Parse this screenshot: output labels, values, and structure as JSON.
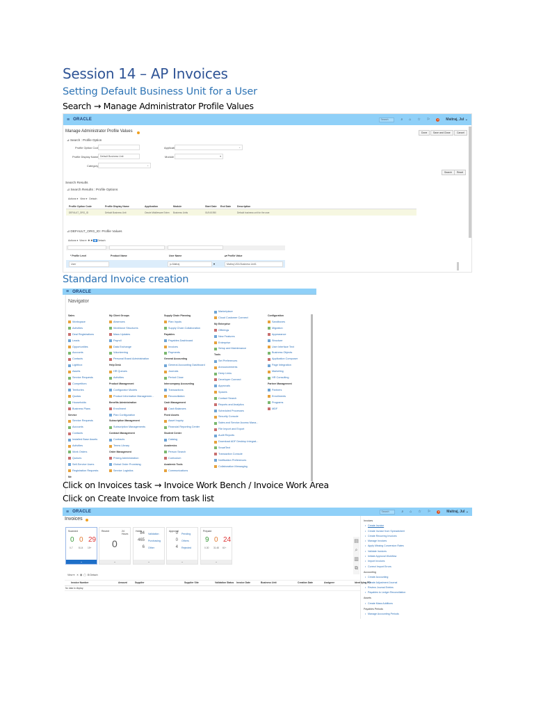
{
  "doc": {
    "title": "Session 14 – AP Invoices",
    "subtitle1": "Setting Default Business Unit for a User",
    "step1": "Search → Manage Administrator Profile Values",
    "subtitle2": "Standard Invoice creation",
    "step2": "Click on Invoices task → Invoice Work Bench / Invoice Work Area",
    "step3": "Click on Create Invoice from task list"
  },
  "topbar": {
    "logo": "ORACLE",
    "search_placeholder": "Search",
    "user": "Maitraj, Jul ⌄",
    "notif_count": "9"
  },
  "profile_screen": {
    "page_title": "Manage Administrator Profile Values",
    "buttons": {
      "done": "Done",
      "save_close": "Save and Close",
      "cancel": "Cancel",
      "search": "Search",
      "reset": "Reset"
    },
    "search_section": "Search : Profile Option",
    "labels": {
      "code": "Profile Option Code",
      "display_name": "Profile Display Name",
      "category": "Category",
      "application": "Application",
      "module": "Module"
    },
    "values": {
      "display_name": "Default Business Unit"
    },
    "results_title": "Search Results",
    "results_section": "Search Results : Profile Options",
    "toolbar": {
      "actions": "Actions ▾",
      "view": "View ▾",
      "detach": "Detach"
    },
    "columns": [
      "Profile Option Code",
      "Profile Display Name",
      "Application",
      "Module",
      "Start Date",
      "End Date",
      "Description"
    ],
    "row": [
      "DEFAULT_ORG_ID",
      "Default Business Unit",
      "Oracle Middleware Exten",
      "Business Units",
      "01/04/1950",
      "",
      "Default business unit for the user."
    ],
    "values_section": "DEFAULT_ORG_ID: Profile Values",
    "values_columns": [
      "* Profile Level",
      "Product Name",
      "User Name",
      "Profile Value"
    ],
    "values_row": {
      "level": "User",
      "product": "",
      "user": "ju.Maitraj",
      "value": "Maitraj USA Business Unit1"
    }
  },
  "navigator": {
    "title": "Navigator",
    "columns": [
      [
        {
          "g": "Sales"
        },
        "Workspace",
        "Activities",
        "Deal Registrations",
        "Leads",
        "Opportunities",
        "Accounts",
        "Contacts",
        "Lightbox",
        "Assets",
        "Service Requests",
        "Competitors",
        "Territories",
        "Quotas",
        "Households",
        "Business Plans",
        {
          "g": "Service"
        },
        "Service Requests",
        "Accounts",
        "Contacts",
        "Installed Base Assets",
        "Activities",
        "Work Orders",
        "Queues",
        "Self-Service Users",
        "Registration Requests",
        {
          "g": "Me"
        }
      ],
      [
        {
          "g": "My Client Groups"
        },
        "Absences",
        "Workforce Structures",
        "Mass Updates",
        "Payroll",
        "Data Exchange",
        "Volunteering",
        "Personal Brand Administration",
        {
          "g": "Help Desk"
        },
        "HR Queues",
        "Activities",
        {
          "g": "Product Management"
        },
        "Configurator Models",
        "Product Information Managemen...",
        {
          "g": "Benefits Administration"
        },
        "Enrollment",
        "Plan Configuration",
        {
          "g": "Subscription Management"
        },
        "Subscription Managements",
        {
          "g": "Contract Management"
        },
        "Contracts",
        "Terms Library",
        {
          "g": "Order Management"
        },
        "Pricing Administration",
        "Global Order Promising",
        "Service Logistics"
      ],
      [
        {
          "g": "Supply Chain Planning"
        },
        "Plan Inputs",
        "Supply Chain Collaboration",
        {
          "g": "Payables"
        },
        "Payables Dashboard",
        "Invoices",
        "Payments",
        {
          "g": "General Accounting"
        },
        "General Accounting Dashboard",
        "Journals",
        "Period Close",
        {
          "g": "Intercompany Accounting"
        },
        "Transactions",
        "Reconciliation",
        {
          "g": "Cash Management"
        },
        "Cash Balances",
        {
          "g": "Fixed Assets"
        },
        "Asset Inquiry",
        "Financial Reporting Center",
        {
          "g": "Student Center"
        },
        "Catalog",
        {
          "g": "Academics"
        },
        "Person Search",
        "Curriculum",
        {
          "g": "Academic Tools"
        },
        "Communications"
      ],
      [
        "Marketplace",
        "Cloud Customer Connect",
        {
          "g": "My Enterprise"
        },
        "Offerings",
        "New Features",
        "Enterprise",
        "Setup and Maintenance",
        {
          "g": "Tools"
        },
        "Set Preferences",
        "Announcements",
        "Deep Links",
        "Developer Connect",
        "Approvals",
        "Spaces",
        "Contact Search",
        "Reports and Analytics",
        "Scheduled Processes",
        "Security Console",
        "Sales and Service Access Mana...",
        "File Import and Export",
        "Audit Reports",
        "Download ADF Desktop Integrat...",
        "SmartText",
        "Transaction Console",
        "Notification Preferences",
        "Collaboration Messaging"
      ],
      [
        {
          "g": "Configuration"
        },
        "Sandboxes",
        "Migration",
        "Appearance",
        "Structure",
        "User Interface Text",
        "Business Objects",
        "Application Composer",
        "Page Integration",
        "Marketing",
        "HR Consulting",
        {
          "g": "Partner Management"
        },
        "Partners",
        "Enrollments",
        "Programs",
        "MDF"
      ]
    ]
  },
  "invoices_screen": {
    "title": "Invoices",
    "tiles": [
      {
        "label": "Scanned",
        "nums": [
          {
            "v": "0",
            "c": "#3a9a3a"
          },
          {
            "v": "0",
            "c": "#e07a30"
          },
          {
            "v": "29",
            "c": "#d33"
          }
        ],
        "subs": [
          "0-7",
          "8-14",
          "15+"
        ]
      },
      {
        "label": "Recent",
        "link": "24 Hours",
        "big": "0"
      },
      {
        "label": "Holds",
        "rows": [
          [
            "84",
            "Validation"
          ],
          [
            "465",
            "Purchasing"
          ],
          [
            "6",
            "Other"
          ]
        ]
      },
      {
        "label": "Approval",
        "rows": [
          [
            "0",
            "Pending"
          ],
          [
            "0",
            "Others"
          ],
          [
            "4",
            "Rejected"
          ]
        ]
      },
      {
        "label": "Prepaid",
        "nums": [
          {
            "v": "9",
            "c": "#3a9a3a"
          },
          {
            "v": "0",
            "c": "#e07a30"
          },
          {
            "v": "24",
            "c": "#d33"
          }
        ],
        "subs": [
          "0-30",
          "31-60",
          "61+"
        ]
      }
    ],
    "toolbar": {
      "view": "View ▾",
      "detach": "Detach"
    },
    "columns": [
      "Invoice Number",
      "Amount",
      "Supplier",
      "Supplier Site",
      "Validation Status",
      "Invoice Date",
      "Business Unit",
      "Creation Date",
      "Assignee",
      "Identifying PO"
    ],
    "empty": "No data to display.",
    "tasks": [
      {
        "g": "Invoices"
      },
      "Create Invoice",
      "Create Invoice from Spreadsheet",
      "Create Recurring Invoices",
      "Manage Invoices",
      "Apply Missing Conversion Rates",
      "Validate Invoices",
      "Initiate Approval Workflow",
      "Import Invoices",
      "Correct Import Errors",
      {
        "g": "Accounting"
      },
      "Create Accounting",
      "Create Adjustment Journal",
      "Review Journal Entries",
      "Payables to Ledger Reconciliation",
      {
        "g": "Assets"
      },
      "Create Mass Additions",
      {
        "g": "Payables Periods"
      },
      "Manage Accounting Periods"
    ]
  }
}
